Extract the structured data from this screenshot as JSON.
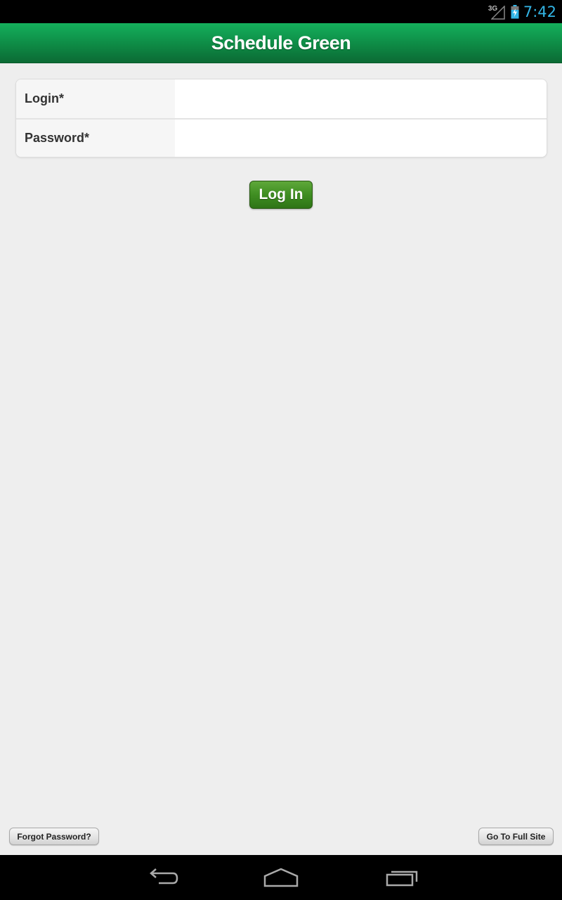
{
  "status_bar": {
    "network_label": "3G",
    "time": "7:42",
    "icons": [
      "signal-icon",
      "battery-charging-icon"
    ]
  },
  "header": {
    "title": "Schedule Green"
  },
  "login_form": {
    "fields": [
      {
        "label": "Login*",
        "value": "",
        "placeholder": ""
      },
      {
        "label": "Password*",
        "value": "",
        "placeholder": ""
      }
    ],
    "submit_label": "Log In"
  },
  "footer": {
    "forgot_password_label": "Forgot Password?",
    "full_site_label": "Go To Full Site"
  },
  "nav_bar": {
    "icons": [
      "back-icon",
      "home-icon",
      "recent-apps-icon"
    ]
  },
  "colors": {
    "header_green": "#0e8a45",
    "button_green": "#3f8e22",
    "clock_blue": "#33b5e5",
    "background": "#eeeeee"
  }
}
